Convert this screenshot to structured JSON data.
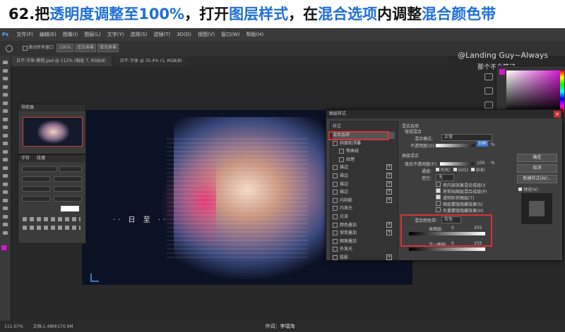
{
  "title": {
    "parts": [
      {
        "text": "62.把",
        "blue": false
      },
      {
        "text": "透明度调整至100%",
        "blue": true
      },
      {
        "text": "，打开",
        "blue": false
      },
      {
        "text": "图层样式",
        "blue": true
      },
      {
        "text": "，在",
        "blue": false
      },
      {
        "text": "混合选项",
        "blue": true
      },
      {
        "text": "内调整",
        "blue": false
      },
      {
        "text": "混合颜色带",
        "blue": true
      }
    ]
  },
  "app": {
    "logo": "Ps",
    "menu": [
      "文件(F)",
      "编辑(E)",
      "图像(I)",
      "图层(L)",
      "文字(Y)",
      "选择(S)",
      "滤镜(T)",
      "3D(D)",
      "视图(V)",
      "窗口(W)",
      "帮助(H)"
    ],
    "options": {
      "scroll_all": "滚动所有窗口",
      "zoom": "100%",
      "fit": "适合屏幕",
      "fill": "填充屏幕"
    },
    "tabs": [
      "日不-字体-教程.psd @ 112% (图层 7, RGB/8)",
      "日不-字体 @ 35.4% (1, RGB/8)"
    ],
    "watermark": "@Landing Guy~Always",
    "watermark2": "那个不会笑了",
    "canvas_caption": "·· 日  至 ··",
    "status_zoom": "111.07%",
    "status_doc": "文档:1.48M/170.9M",
    "credit": "作词：李瑞淘"
  },
  "navigator": {
    "title": "导航器"
  },
  "character": {
    "title": "字符",
    "title2": "段落"
  },
  "dialog": {
    "title": "图层样式",
    "list_header": "样式",
    "items": [
      {
        "label": "混合选项",
        "checkbox": false,
        "plus": false
      },
      {
        "label": "斜面和浮雕",
        "checkbox": true,
        "plus": false
      },
      {
        "label": "等高线",
        "checkbox": true,
        "plus": false
      },
      {
        "label": "纹理",
        "checkbox": true,
        "plus": false
      },
      {
        "label": "描边",
        "checkbox": true,
        "plus": true
      },
      {
        "label": "描边",
        "checkbox": true,
        "plus": true
      },
      {
        "label": "描边",
        "checkbox": true,
        "plus": true
      },
      {
        "label": "描边",
        "checkbox": true,
        "plus": true
      },
      {
        "label": "内阴影",
        "checkbox": true,
        "plus": true
      },
      {
        "label": "内发光",
        "checkbox": true,
        "plus": false
      },
      {
        "label": "光泽",
        "checkbox": true,
        "plus": false
      },
      {
        "label": "颜色叠加",
        "checkbox": true,
        "plus": true
      },
      {
        "label": "渐变叠加",
        "checkbox": true,
        "plus": true
      },
      {
        "label": "图案叠加",
        "checkbox": true,
        "plus": false
      },
      {
        "label": "外发光",
        "checkbox": true,
        "plus": false
      },
      {
        "label": "投影",
        "checkbox": true,
        "plus": true
      }
    ],
    "section_general": "混合选项",
    "general_sub": "常规混合",
    "blend_mode_label": "混合模式:",
    "blend_mode_value": "正常",
    "opacity_label": "不透明度(O):",
    "opacity_value": "100",
    "pct": "%",
    "section_advanced": "高级混合",
    "fill_opacity_label": "填充不透明度(F):",
    "fill_opacity_value": "100",
    "channels_label": "通道:",
    "channels": [
      "R(R)",
      "G(G)",
      "B(B)"
    ],
    "knockout_label": "挖空:",
    "knockout_value": "无",
    "adv_options": [
      "将内部效果混合成组(I)",
      "将剪贴图层混合成组(P)",
      "透明形状图层(T)",
      "图层蒙版隐藏效果(S)",
      "矢量蒙版隐藏效果(H)"
    ],
    "blend_if_label": "混合颜色带:",
    "blend_if_value": "灰色",
    "this_layer_label": "本图层:",
    "this_layer_min": "0",
    "this_layer_max": "255",
    "under_layer_label": "下一图层:",
    "under_layer_min": "0",
    "under_layer_max": "255",
    "ok": "确定",
    "cancel": "取消",
    "new_style": "新建样式(W)...",
    "preview": "预览(V)"
  },
  "colors": {
    "blue": "#1e6fd8",
    "red": "#d83434",
    "magenta": "#d21bd0"
  }
}
